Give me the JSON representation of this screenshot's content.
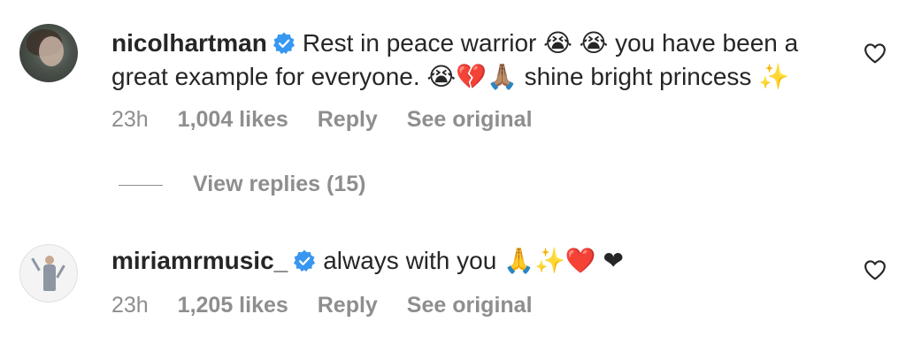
{
  "comments": [
    {
      "username": "nicolhartman",
      "text": "Rest in peace warrior 😭 😭 you have been a great example for everyone. 😭💔🙏🏽 shine bright princess ✨",
      "time": "23h",
      "likes": "1,004 likes",
      "reply": "Reply",
      "see_original": "See original"
    },
    {
      "username": "miriamrmusic_",
      "text": "always with you 🙏✨❤️ ❤",
      "time": "23h",
      "likes": "1,205 likes",
      "reply": "Reply",
      "see_original": "See original"
    }
  ],
  "view_replies": "View replies (15)",
  "icons": {
    "verified": "verified-badge-icon",
    "like": "heart-outline-icon"
  },
  "colors": {
    "verified_blue": "#3897f0",
    "text": "#262626",
    "secondary": "#8e8e8e"
  }
}
